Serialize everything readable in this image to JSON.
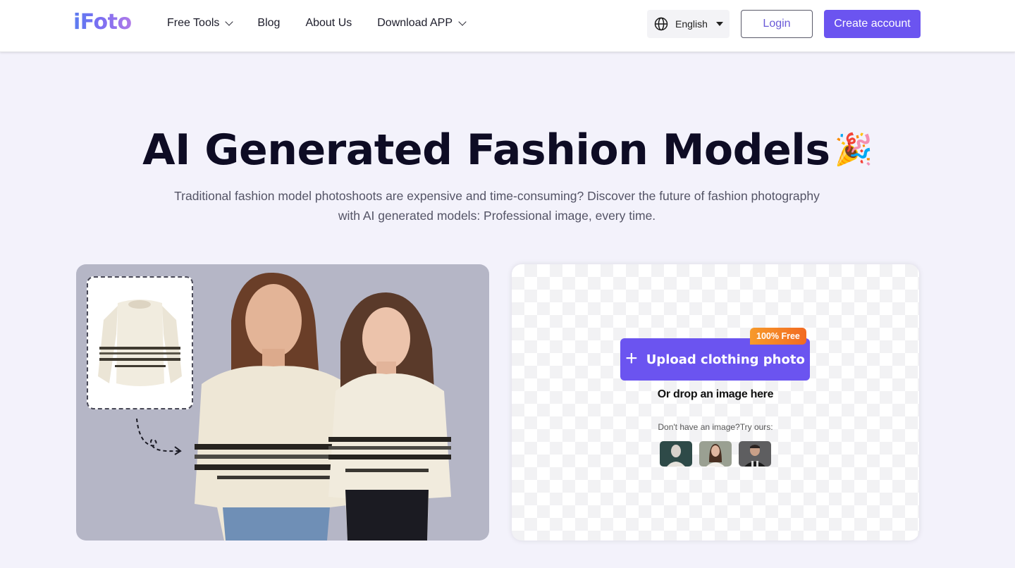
{
  "header": {
    "logo": "iFoto",
    "nav": [
      {
        "label": "Free Tools",
        "has_dropdown": true
      },
      {
        "label": "Blog",
        "has_dropdown": false
      },
      {
        "label": "About Us",
        "has_dropdown": false
      },
      {
        "label": "Download APP",
        "has_dropdown": true
      }
    ],
    "language": {
      "icon": "globe-icon",
      "selected": "English"
    },
    "login_label": "Login",
    "create_account_label": "Create account"
  },
  "hero": {
    "title": "AI Generated Fashion Models",
    "title_emoji": "🎉",
    "subtitle_line1": "Traditional fashion model photoshoots are expensive and time-consuming? Discover the future of fashion photography",
    "subtitle_line2": "with AI generated models: Professional image, every time."
  },
  "showcase": {
    "garment_alt": "cream knit sweater with dark stripes",
    "models_alt": "two AI-generated models wearing the sweater"
  },
  "upload": {
    "button_label": "Upload clothing photo",
    "badge": "100% Free",
    "drop_text": "Or drop an image here",
    "try_text": "Don't have an image?Try ours:",
    "samples": [
      {
        "name": "sample-mannequin"
      },
      {
        "name": "sample-woman"
      },
      {
        "name": "sample-man"
      }
    ]
  },
  "colors": {
    "accent": "#6b54f0",
    "page_bg": "#f3f2fb",
    "badge_orange": "#f47e26",
    "title": "#0e0c24"
  }
}
